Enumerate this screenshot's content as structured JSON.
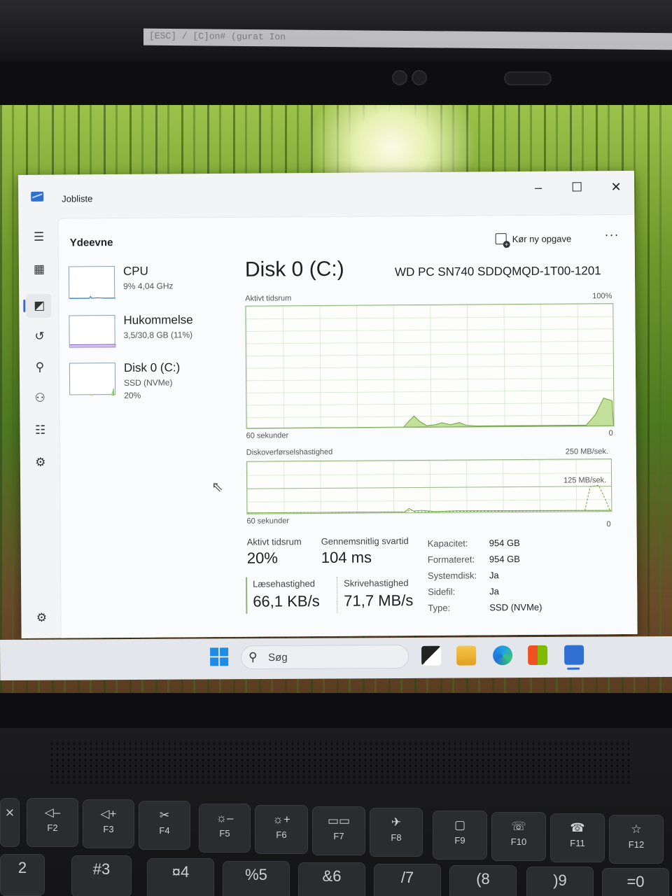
{
  "top_strip": {
    "text": "[ESC] / [C]on# (gurat Ion"
  },
  "window": {
    "app_title": "Jobliste",
    "controls": {
      "minimize": "–",
      "maximize": "☐",
      "close": "✕"
    }
  },
  "header": {
    "page_title": "Ydeevne",
    "run_task_label": "Kør ny opgave",
    "more_label": "···"
  },
  "devices": [
    {
      "name": "CPU",
      "sub": "9%  4,04 GHz",
      "sub2": ""
    },
    {
      "name": "Hukommelse",
      "sub": "3,5/30,8 GB (11%)",
      "sub2": ""
    },
    {
      "name": "Disk 0 (C:)",
      "sub": "SSD (NVMe)",
      "sub2": "20%"
    }
  ],
  "disk": {
    "title": "Disk 0 (C:)",
    "model": "WD PC SN740 SDDQMQD-1T00-1201",
    "active_time_graph": {
      "label": "Aktivt tidsrum",
      "max_label": "100%",
      "time_label": "60 sekunder",
      "min_label": "0"
    },
    "transfer_graph": {
      "label": "Diskoverførselshastighed",
      "max_label": "250 MB/sek.",
      "mid_label": "125 MB/sek.",
      "time_label": "60 sekunder",
      "min_label": "0"
    },
    "stats": {
      "active_time_label": "Aktivt tidsrum",
      "active_time_value": "20%",
      "avg_response_label": "Gennemsnitlig svartid",
      "avg_response_value": "104 ms",
      "read_label": "Læsehastighed",
      "read_value": "66,1 KB/s",
      "write_label": "Skrivehastighed",
      "write_value": "71,7 MB/s"
    },
    "properties": [
      {
        "key": "Kapacitet:",
        "value": "954 GB"
      },
      {
        "key": "Formateret:",
        "value": "954 GB"
      },
      {
        "key": "Systemdisk:",
        "value": "Ja"
      },
      {
        "key": "Sidefil:",
        "value": "Ja"
      },
      {
        "key": "Type:",
        "value": "SSD (NVMe)"
      }
    ]
  },
  "taskbar": {
    "search_placeholder": "Søg"
  },
  "keyboard": {
    "fn_keys": [
      {
        "glyph": "◁–",
        "label": "F2"
      },
      {
        "glyph": "◁+",
        "label": "F3"
      },
      {
        "glyph": "✂",
        "label": "F4"
      },
      {
        "glyph": "☼–",
        "label": "F5"
      },
      {
        "glyph": "☼+",
        "label": "F6"
      },
      {
        "glyph": "▭▭",
        "label": "F7"
      },
      {
        "glyph": "✈",
        "label": "F8"
      },
      {
        "glyph": "▢",
        "label": "F9"
      },
      {
        "glyph": "☏",
        "label": "F10"
      },
      {
        "glyph": "☎",
        "label": "F11"
      },
      {
        "glyph": "☆",
        "label": "F12"
      }
    ],
    "number_keys": [
      "2",
      "#3",
      "¤4",
      "%5",
      "&6",
      "/7",
      "(8",
      ")9",
      "=0"
    ]
  }
}
